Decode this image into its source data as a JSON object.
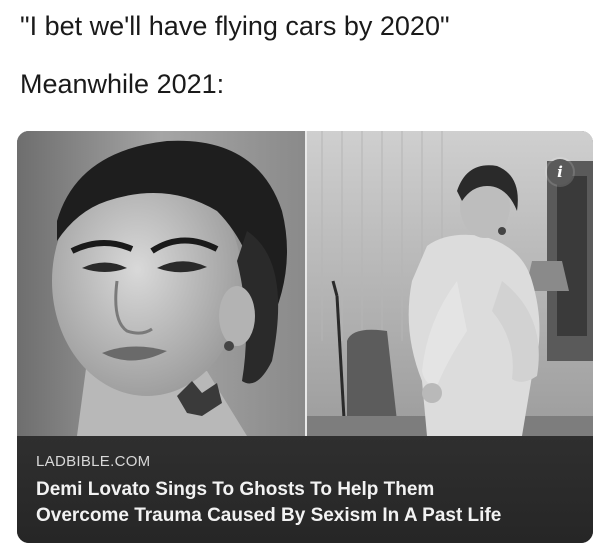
{
  "caption": {
    "line1": "\"I bet we'll have flying cars by 2020\"",
    "line2": "Meanwhile 2021:"
  },
  "card": {
    "source": "LADBIBLE.COM",
    "headline_line1": "Demi Lovato Sings To Ghosts To Help Them",
    "headline_line2": "Overcome Trauma Caused By Sexism In A Past Life",
    "info_glyph": "i"
  },
  "icons": {
    "info": "info-icon"
  }
}
